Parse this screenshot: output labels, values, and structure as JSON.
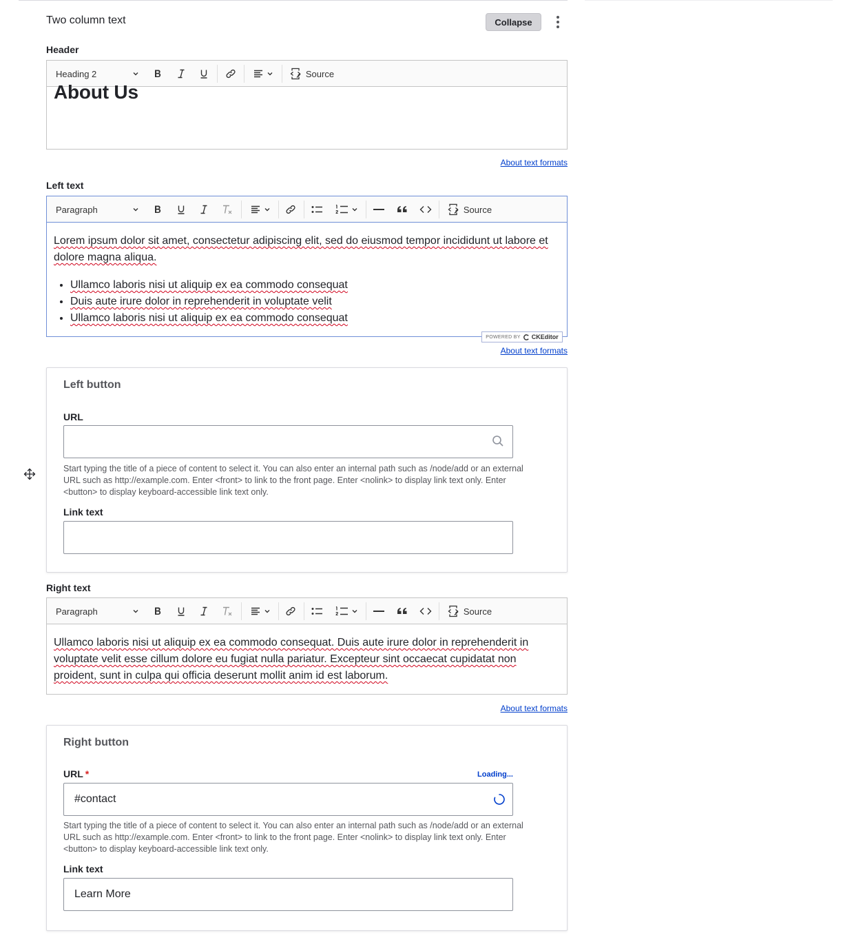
{
  "panel": {
    "title": "Two column text",
    "collapse_label": "Collapse"
  },
  "header_field": {
    "label": "Header",
    "format_select": "Heading 2",
    "source_label": "Source",
    "content": "About Us",
    "format_link": "About text formats"
  },
  "left_text": {
    "label": "Left text",
    "format_select": "Paragraph",
    "source_label": "Source",
    "paragraph": "Lorem ipsum dolor sit amet, consectetur adipiscing elit, sed do eiusmod tempor incididunt ut labore et dolore magna aliqua.",
    "bullets": [
      "Ullamco laboris nisi ut aliquip ex ea commodo consequat",
      "Duis aute irure dolor in reprehenderit in voluptate velit",
      "Ullamco laboris nisi ut aliquip ex ea commodo consequat"
    ],
    "powered_by": "POWERED BY",
    "ckeditor": "CKEditor",
    "format_link": "About text formats"
  },
  "left_button": {
    "title": "Left button",
    "url_label": "URL",
    "url_value": "",
    "url_help": "Start typing the title of a piece of content to select it. You can also enter an internal path such as /node/add or an external URL such as http://example.com. Enter <front> to link to the front page. Enter <nolink> to display link text only. Enter <button> to display keyboard-accessible link text only.",
    "link_text_label": "Link text",
    "link_text_value": ""
  },
  "right_text": {
    "label": "Right text",
    "format_select": "Paragraph",
    "source_label": "Source",
    "paragraph": "Ullamco laboris nisi ut aliquip ex ea commodo consequat. Duis aute irure dolor in reprehenderit in voluptate velit esse cillum dolore eu fugiat nulla pariatur. Excepteur sint occaecat cupidatat non proident, sunt in culpa qui officia deserunt mollit anim id est laborum.",
    "format_link": "About text formats"
  },
  "right_button": {
    "title": "Right button",
    "url_label": "URL",
    "required_mark": "*",
    "loading": "Loading...",
    "url_value": "#contact",
    "url_help": "Start typing the title of a piece of content to select it. You can also enter an internal path such as /node/add or an external URL such as http://example.com. Enter <front> to link to the front page. Enter <nolink> to display link text only. Enter <button> to display keyboard-accessible link text only.",
    "link_text_label": "Link text",
    "link_text_value": "Learn More"
  },
  "icons": [
    "drag-handle-icon",
    "kebab-icon",
    "bold-icon",
    "italic-icon",
    "underline-icon",
    "link-icon",
    "align-icon",
    "source-icon",
    "remove-format-icon",
    "bulleted-list-icon",
    "numbered-list-icon",
    "horizontal-line-icon",
    "blockquote-icon",
    "code-icon",
    "search-icon",
    "spinner-icon"
  ],
  "colors": {
    "link": "#003ecc",
    "required": "#d72222",
    "spellcheck": "#d0021b"
  }
}
